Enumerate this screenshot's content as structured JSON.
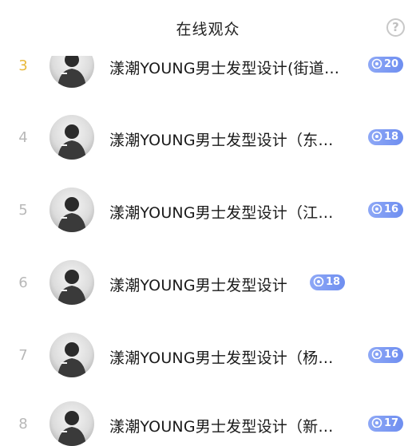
{
  "header": {
    "title": "在线观众",
    "help_label": "?"
  },
  "viewers": [
    {
      "rank": "3",
      "name": "漾潮YOUNG男士发型设计(街道…",
      "level": "20"
    },
    {
      "rank": "4",
      "name": "漾潮YOUNG男士发型设计（东…",
      "level": "18"
    },
    {
      "rank": "5",
      "name": "漾潮YOUNG男士发型设计（江…",
      "level": "16"
    },
    {
      "rank": "6",
      "name": "漾潮YOUNG男士发型设计",
      "level": "18"
    },
    {
      "rank": "7",
      "name": "漾潮YOUNG男士发型设计（杨…",
      "level": "16"
    },
    {
      "rank": "8",
      "name": "漾潮YOUNG男士发型设计（新…",
      "level": "17"
    }
  ],
  "colors": {
    "rank_highlight": "#e8b93c",
    "badge": "#7b97f3"
  },
  "icons": {
    "help": "question-circle-icon",
    "badge": "fan-level-icon"
  }
}
